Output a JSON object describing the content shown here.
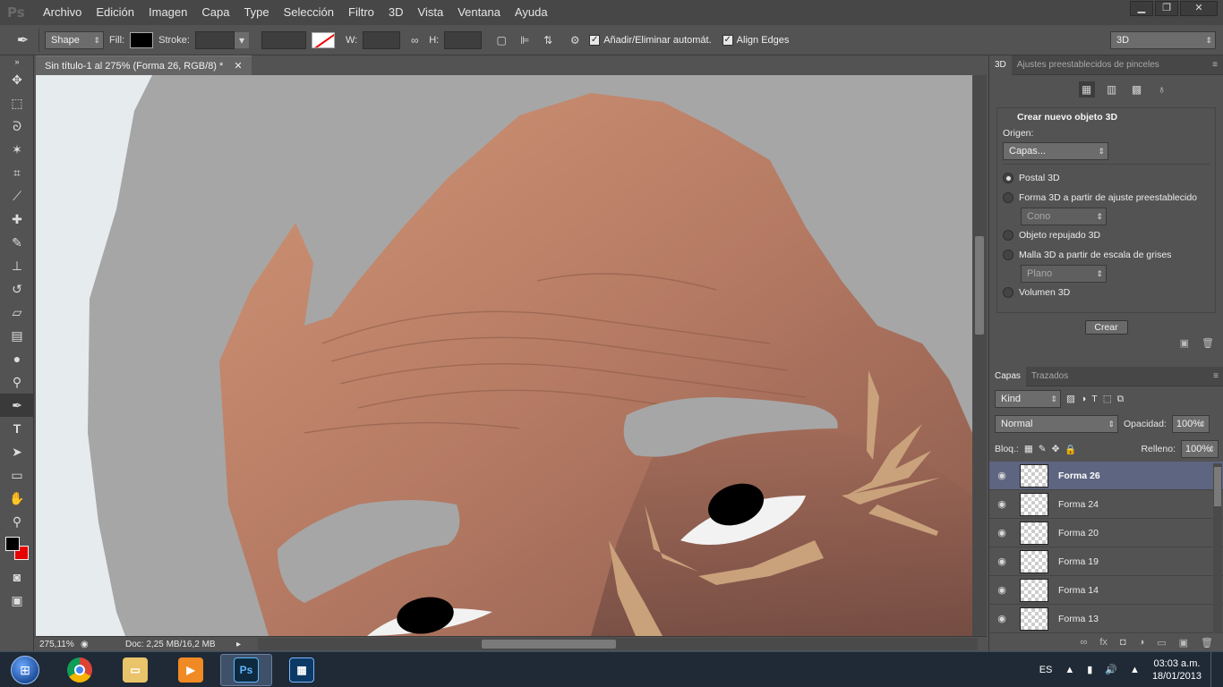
{
  "menubar": {
    "logo": "Ps",
    "items": [
      "Archivo",
      "Edición",
      "Imagen",
      "Capa",
      "Type",
      "Selección",
      "Filtro",
      "3D",
      "Vista",
      "Ventana",
      "Ayuda"
    ],
    "window_controls": [
      "▁",
      "❐",
      "✕"
    ]
  },
  "options": {
    "mode": "Shape",
    "fill_label": "Fill:",
    "stroke_label": "Stroke:",
    "w_label": "W:",
    "h_label": "H:",
    "auto_add": "Añadir/Eliminar automát.",
    "align_edges": "Align Edges",
    "workspace": "3D"
  },
  "document": {
    "tab_title": "Sin título-1 al 275% (Forma 26, RGB/8) *",
    "tab_close": "✕",
    "zoom": "275,11%",
    "doc_size": "Doc: 2,25 MB/16,2 MB"
  },
  "panel3d": {
    "tabs": [
      "3D",
      "Ajustes preestablecidos de pinceles"
    ],
    "title": "Crear nuevo objeto 3D",
    "origin_label": "Origen:",
    "origin_value": "Capas...",
    "options": [
      "Postal 3D",
      "Forma 3D a partir de ajuste preestablecido",
      "Objeto repujado 3D",
      "Malla 3D a partir de escala de grises",
      "Volumen 3D"
    ],
    "preset_value": "Cono",
    "grayscale_value": "Plano",
    "create_button": "Crear"
  },
  "layers": {
    "tabs": [
      "Capas",
      "Trazados"
    ],
    "filter": "Kind",
    "blend_mode": "Normal",
    "opacity_label": "Opacidad:",
    "opacity_value": "100%",
    "lock_label": "Bloq.:",
    "fill_label": "Relleno:",
    "fill_value": "100%",
    "items": [
      {
        "name": "Forma 26",
        "selected": true
      },
      {
        "name": "Forma 24",
        "selected": false
      },
      {
        "name": "Forma 20",
        "selected": false
      },
      {
        "name": "Forma 19",
        "selected": false
      },
      {
        "name": "Forma 14",
        "selected": false
      },
      {
        "name": "Forma 13",
        "selected": false
      }
    ]
  },
  "taskbar": {
    "apps": [
      "chrome",
      "explorer",
      "media",
      "Ps",
      "photoshop-preview"
    ],
    "language": "ES",
    "time": "03:03 a.m.",
    "date": "18/01/2013"
  },
  "colors": {
    "foreground": "#000000",
    "background": "#e60000",
    "selection": "#5d6580"
  }
}
